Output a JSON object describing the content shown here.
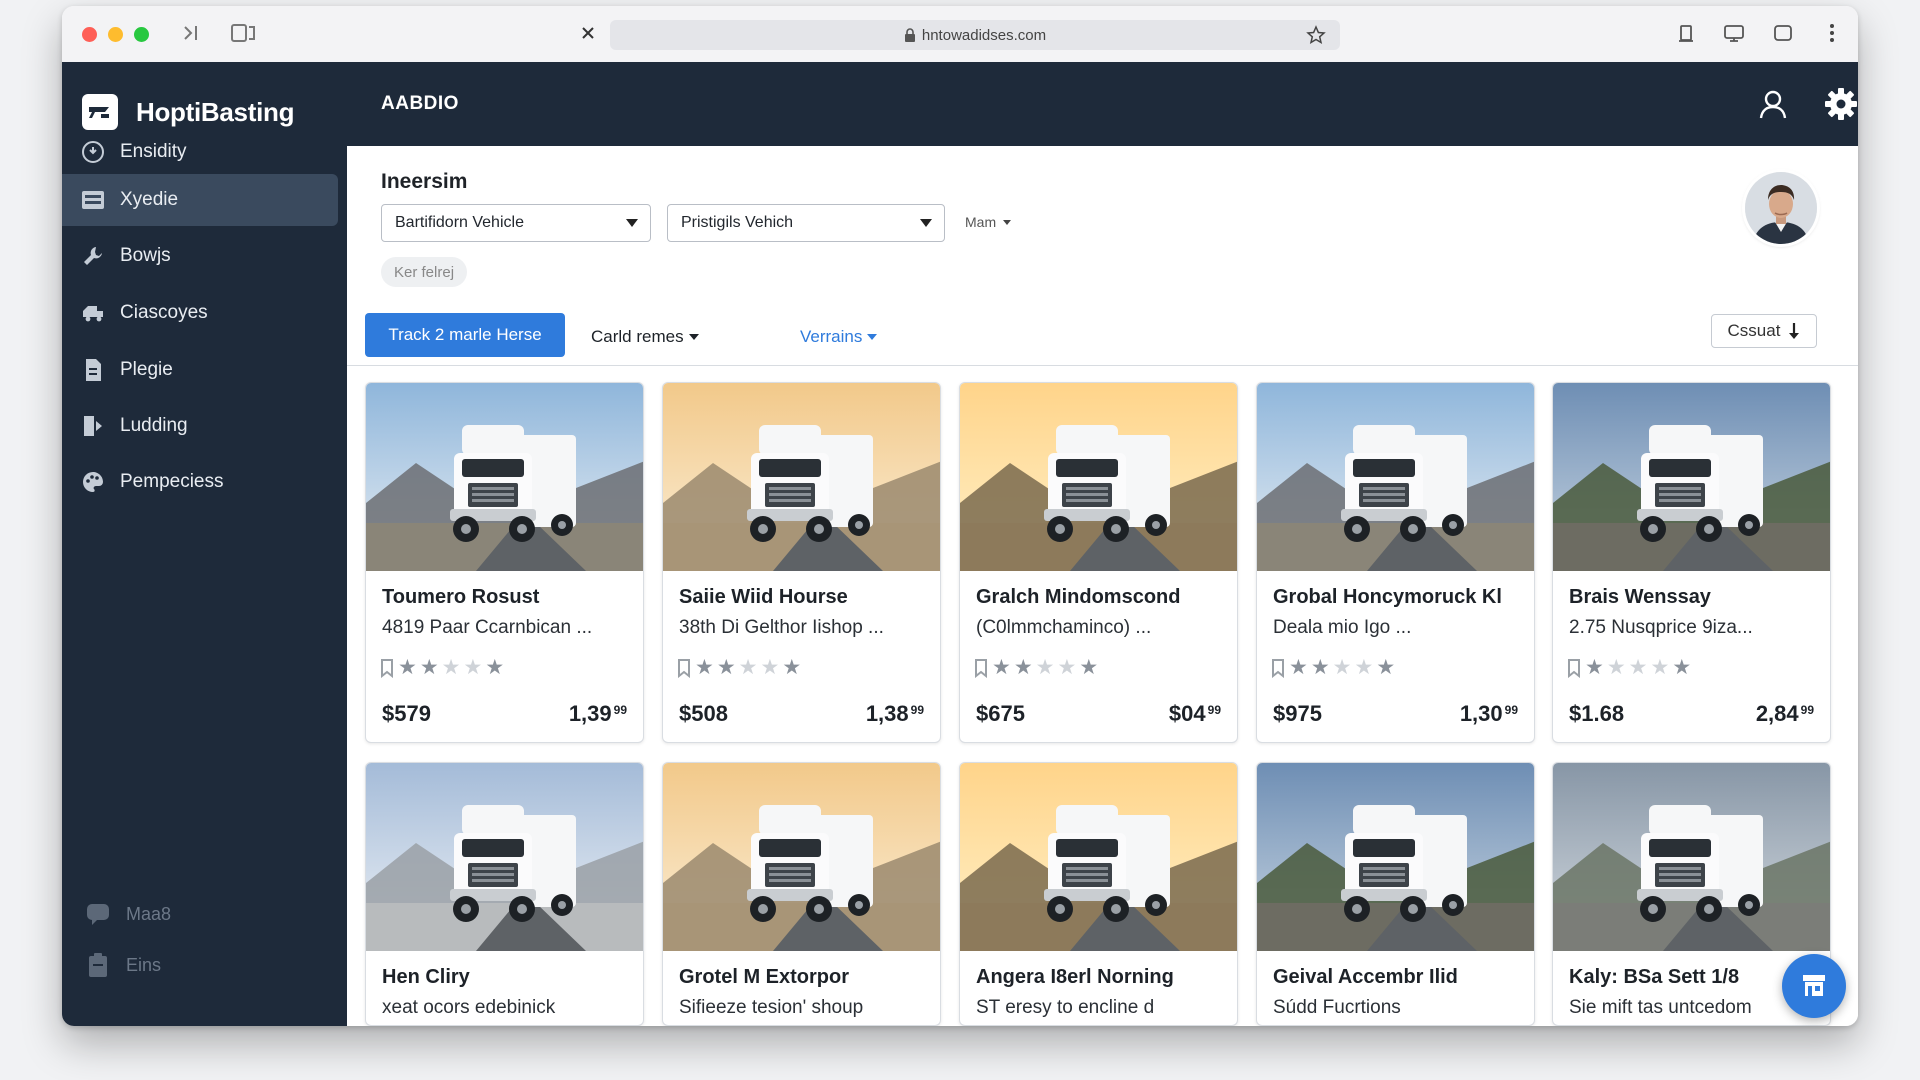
{
  "browser": {
    "url": "hntowadidses.com"
  },
  "app": {
    "name": "HoptiBasting",
    "header_title": "AABDIO"
  },
  "sidebar": {
    "items": [
      {
        "label": "Ensidity",
        "icon": "info-circle-icon"
      },
      {
        "label": "Xyedie",
        "icon": "table-icon",
        "active": true
      },
      {
        "label": "Bowjs",
        "icon": "wrench-icon"
      },
      {
        "label": "Ciascoyes",
        "icon": "truck-icon"
      },
      {
        "label": "Plegie",
        "icon": "document-icon"
      },
      {
        "label": "Ludding",
        "icon": "flag-icon"
      },
      {
        "label": "Pempeciess",
        "icon": "palette-icon"
      }
    ],
    "bottom_items": [
      {
        "label": "Maa8",
        "icon": "chat-icon"
      },
      {
        "label": "Eins",
        "icon": "clipboard-icon"
      }
    ]
  },
  "filters": {
    "section_title": "Ineersim",
    "select_1": "Bartifidorn Vehicle",
    "select_2": "Pristigils Vehich",
    "small_dropdown": "Mam",
    "chip": "Ker felrej"
  },
  "toolbar": {
    "primary_button": "Track 2 marle Herse",
    "dropdown_1": "Carld remes",
    "dropdown_2": "Verrains",
    "sort_button": "Cssuat"
  },
  "colors": {
    "sidebar_bg": "#1e2a3a",
    "accent": "#2f7bdc",
    "star_filled": "#8a919a",
    "star_empty": "#cfd3d8"
  },
  "cards": [
    {
      "title": "Toumero Rosust",
      "subtitle": "4819 Paar Ccarnbican ...",
      "rating": 2,
      "price_a": "$579",
      "price_b": "1,39",
      "price_b_cents": "99",
      "scene": "mountain"
    },
    {
      "title": "Saiie Wiid Hourse",
      "subtitle": "38th Di Gelthor Iishop ...",
      "rating": 2,
      "price_a": "$508",
      "price_b": "1,38",
      "price_b_cents": "99",
      "scene": "sunset"
    },
    {
      "title": "Gralch Mindomscond",
      "subtitle": "(C0lmmchaminco) ...",
      "rating": 2,
      "price_a": "$675",
      "price_b": "$04",
      "price_b_cents": "99",
      "scene": "golden"
    },
    {
      "title": "Grobal Honcymoruck Kl",
      "subtitle": "Deala mio Igo ...",
      "rating": 2,
      "price_a": "$975",
      "price_b": "1,30",
      "price_b_cents": "99",
      "scene": "mountain"
    },
    {
      "title": "Brais Wenssay",
      "subtitle": "2.75 Nusqprice 9iza...",
      "rating": 1,
      "price_a": "$1.68",
      "price_b": "2,84",
      "price_b_cents": "99",
      "scene": "forest"
    },
    {
      "title": "Hen Cliry",
      "subtitle": "хeat ocors edebinick",
      "rating": 0,
      "price_a": "",
      "price_b": "",
      "price_b_cents": "",
      "scene": "studio"
    },
    {
      "title": "Grotel M Extorpor",
      "subtitle": "Sifieeze tesion' shoup",
      "rating": 0,
      "price_a": "",
      "price_b": "",
      "price_b_cents": "",
      "scene": "sunset"
    },
    {
      "title": "Angera I8erl Norning",
      "subtitle": "ST  eresy to encline d",
      "rating": 0,
      "price_a": "",
      "price_b": "",
      "price_b_cents": "",
      "scene": "golden"
    },
    {
      "title": "Geival Accembr Ilid",
      "subtitle": "Súdd Fucrtions",
      "rating": 0,
      "price_a": "",
      "price_b": "",
      "price_b_cents": "",
      "scene": "forest"
    },
    {
      "title": "Kaly: BSa Sett 1/8",
      "subtitle": "Sie mift  tas untcedom",
      "rating": 0,
      "price_a": "",
      "price_b": "",
      "price_b_cents": "",
      "scene": "cloudy"
    }
  ]
}
